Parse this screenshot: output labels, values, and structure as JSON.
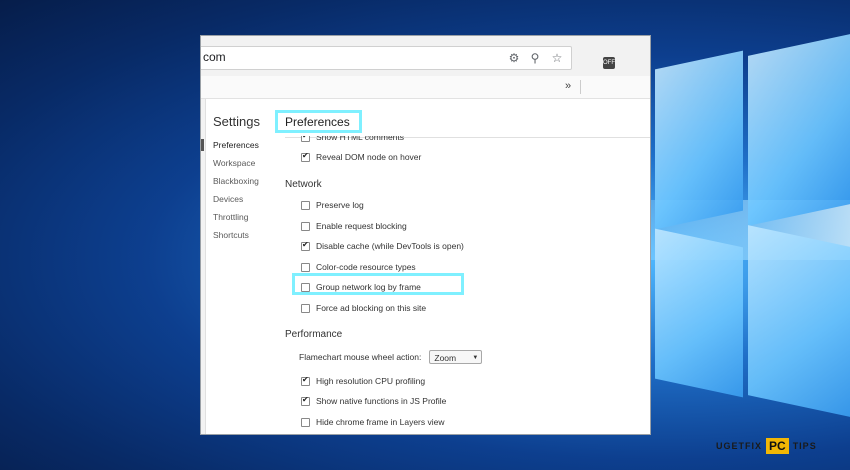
{
  "browser": {
    "url_text": "com",
    "icons": [
      "translate-icon",
      "zoom-icon",
      "star-icon"
    ],
    "extension_label": "OFF",
    "bookmarks_overflow": "»"
  },
  "settings": {
    "title": "Settings",
    "nav": [
      "Preferences",
      "Workspace",
      "Blackboxing",
      "Devices",
      "Throttling",
      "Shortcuts"
    ],
    "selected": "Preferences"
  },
  "preferences": {
    "title": "Preferences",
    "elements_partial": [
      {
        "label": "Show HTML comments",
        "checked": true
      },
      {
        "label": "Reveal DOM node on hover",
        "checked": true
      }
    ],
    "network_title": "Network",
    "network": [
      {
        "label": "Preserve log",
        "checked": false
      },
      {
        "label": "Enable request blocking",
        "checked": false
      },
      {
        "label": "Disable cache (while DevTools is open)",
        "checked": true
      },
      {
        "label": "Color-code resource types",
        "checked": false
      },
      {
        "label": "Group network log by frame",
        "checked": false
      },
      {
        "label": "Force ad blocking on this site",
        "checked": false
      }
    ],
    "performance_title": "Performance",
    "flamechart_label": "Flamechart mouse wheel action:",
    "flamechart_value": "Zoom",
    "performance": [
      {
        "label": "High resolution CPU profiling",
        "checked": true
      },
      {
        "label": "Show native functions in JS Profile",
        "checked": true
      },
      {
        "label": "Hide chrome frame in Layers view",
        "checked": false
      }
    ]
  },
  "watermark": {
    "left": "UGETFIX",
    "box": "PC",
    "right": "TIPS"
  },
  "colors": {
    "highlight": "#7ff0ff",
    "logo_box": "#f2b705"
  }
}
